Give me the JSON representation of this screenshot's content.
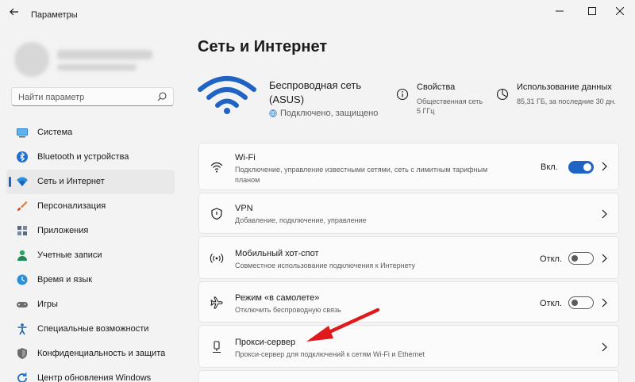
{
  "app": {
    "title": "Параметры"
  },
  "search": {
    "placeholder": "Найти параметр"
  },
  "sidebar": {
    "items": [
      {
        "label": "Система",
        "icon": "system-icon"
      },
      {
        "label": "Bluetooth и устройства",
        "icon": "bluetooth-icon"
      },
      {
        "label": "Сеть и Интернет",
        "icon": "network-icon",
        "active": true
      },
      {
        "label": "Персонализация",
        "icon": "brush-icon"
      },
      {
        "label": "Приложения",
        "icon": "apps-icon"
      },
      {
        "label": "Учетные записи",
        "icon": "account-icon"
      },
      {
        "label": "Время и язык",
        "icon": "globe-clock-icon"
      },
      {
        "label": "Игры",
        "icon": "gamepad-icon"
      },
      {
        "label": "Специальные возможности",
        "icon": "accessibility-icon"
      },
      {
        "label": "Конфиденциальность и защита",
        "icon": "shield-icon"
      },
      {
        "label": "Центр обновления Windows",
        "icon": "update-icon"
      }
    ]
  },
  "main": {
    "title": "Сеть и Интернет",
    "network": {
      "name": "Беспроводная сеть (ASUS)",
      "status": "Подключено, защищено"
    },
    "properties": {
      "title": "Свойства",
      "line1": "Общественная сеть",
      "line2": "5 ГГц"
    },
    "data_usage": {
      "title": "Использование данных",
      "line1": "85,31 ГБ, за последние 30 дн."
    },
    "cards": {
      "wifi": {
        "title": "Wi-Fi",
        "subtitle": "Подключение, управление известными сетями, сеть с лимитным тарифным планом",
        "toggle_label": "Вкл.",
        "toggle_on": true
      },
      "vpn": {
        "title": "VPN",
        "subtitle": "Добавление, подключение, управление"
      },
      "hotspot": {
        "title": "Мобильный хот-спот",
        "subtitle": "Совместное использование подключения к Интернету",
        "toggle_label": "Откл.",
        "toggle_on": false
      },
      "airplane": {
        "title": "Режим «в самолете»",
        "subtitle": "Отключить беспроводную связь",
        "toggle_label": "Откл.",
        "toggle_on": false
      },
      "proxy": {
        "title": "Прокси-сервер",
        "subtitle": "Прокси-сервер для подключений к сетям Wi-Fi и Ethernet"
      }
    }
  },
  "colors": {
    "accent": "#1f63c5",
    "annotation_arrow": "#e0191d",
    "background": "#f3f3f3"
  }
}
